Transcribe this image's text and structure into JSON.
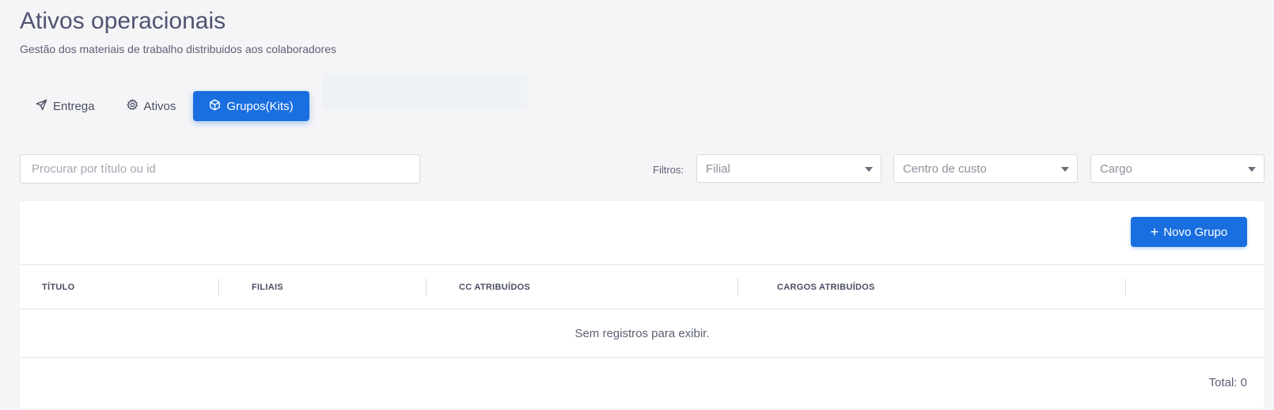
{
  "header": {
    "title": "Ativos operacionais",
    "subtitle": "Gestão dos materiais de trabalho distribuidos aos colaboradores"
  },
  "tabs": [
    {
      "label": "Entrega",
      "icon": "send-icon",
      "active": false
    },
    {
      "label": "Ativos",
      "icon": "gear-icon",
      "active": false
    },
    {
      "label": "Grupos(Kits)",
      "icon": "box-icon",
      "active": true
    }
  ],
  "search": {
    "placeholder": "Procurar por título ou id",
    "value": ""
  },
  "filters": {
    "label": "Filtros:",
    "branch": "Filial",
    "cost_center": "Centro de custo",
    "role": "Cargo"
  },
  "toolbar": {
    "new_group_label": "Novo Grupo",
    "new_group_icon": "plus-icon"
  },
  "table": {
    "columns": [
      "TÍTULO",
      "FILIAIS",
      "CC ATRIBUÍDOS",
      "CARGOS ATRIBUÍDOS"
    ],
    "empty_message": "Sem registros para exibir.",
    "total": "Total: 0"
  },
  "colors": {
    "accent": "#1a6fe0",
    "background": "#f5f5f7",
    "card": "#ffffff"
  }
}
